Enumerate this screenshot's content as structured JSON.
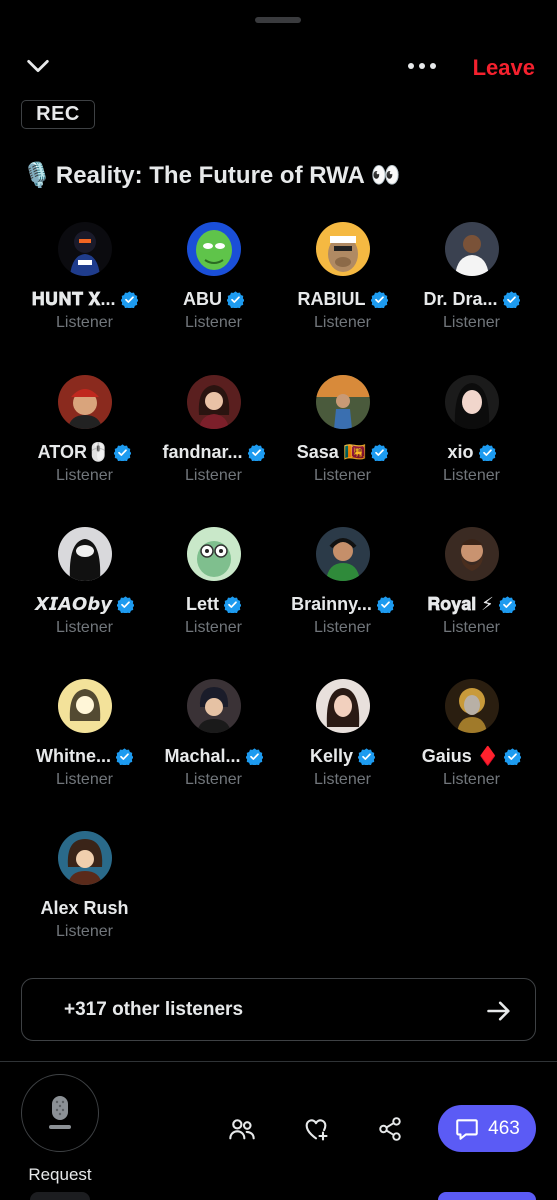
{
  "header": {
    "leave_label": "Leave",
    "rec_label": "REC",
    "title_emoji": "🎙️",
    "title": "Reality: The Future of RWA 👀"
  },
  "colors": {
    "background": "#000000",
    "leave": "#f4212e",
    "verified": "#1d9bf0",
    "muted_text": "#71767b",
    "chat_button": "#5b5bf5"
  },
  "participants": [
    {
      "name": "𝐇𝐔𝐍𝐓 𝐗...",
      "role": "Listener",
      "verified": true
    },
    {
      "name": "ABU",
      "role": "Listener",
      "verified": true
    },
    {
      "name": "RABIUL",
      "role": "Listener",
      "verified": true
    },
    {
      "name": "Dr. Dra...",
      "role": "Listener",
      "verified": true
    },
    {
      "name": "ATOR🖱️",
      "role": "Listener",
      "verified": true
    },
    {
      "name": "fandnar...",
      "role": "Listener",
      "verified": true
    },
    {
      "name": "Sasa 🇱🇰",
      "role": "Listener",
      "verified": true
    },
    {
      "name": "xio",
      "role": "Listener",
      "verified": true
    },
    {
      "name": "𝙓𝙄𝘼𝙊𝙗𝙮",
      "role": "Listener",
      "verified": true
    },
    {
      "name": "Lett",
      "role": "Listener",
      "verified": true
    },
    {
      "name": "Brainny...",
      "role": "Listener",
      "verified": true
    },
    {
      "name": "𝐑𝐨𝐲𝐚𝐥 ⚡",
      "role": "Listener",
      "verified": true
    },
    {
      "name": "Whitne...",
      "role": "Listener",
      "verified": true
    },
    {
      "name": "Machal...",
      "role": "Listener",
      "verified": true
    },
    {
      "name": "Kelly",
      "role": "Listener",
      "verified": true
    },
    {
      "name": "Gaius ♦️",
      "role": "Listener",
      "verified": true
    },
    {
      "name": "Alex Rush",
      "role": "Listener",
      "verified": false
    }
  ],
  "other_listeners": {
    "label": "+317 other listeners"
  },
  "footer": {
    "request_label": "Request",
    "chat_count": "463",
    "icons": [
      "microphone-icon",
      "people-icon",
      "heart-plus-icon",
      "share-icon",
      "chat-bubble-icon"
    ]
  }
}
